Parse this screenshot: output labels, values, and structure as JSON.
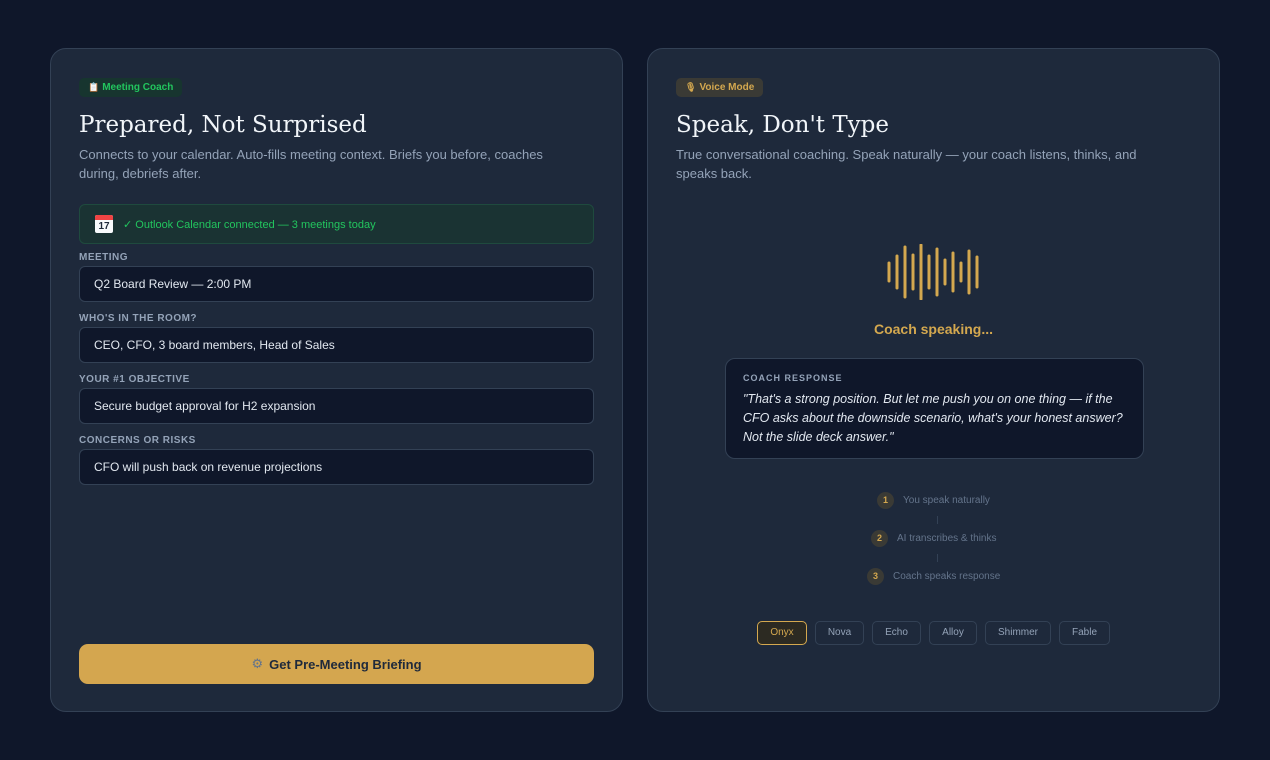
{
  "left_card": {
    "badge_label": "Meeting Coach",
    "badge_icon": "clipboard-icon",
    "title": "Prepared, Not Surprised",
    "description": "Connects to your calendar. Auto-fills meeting context. Briefs you before, coaches during, debriefs after.",
    "calendar": {
      "icon": "calendar-icon",
      "icon_month": "JUL",
      "icon_day": "17",
      "status": "✓ Outlook Calendar connected — 3 meetings today"
    },
    "fields": [
      {
        "label": "MEETING",
        "value": "Q2 Board Review — 2:00 PM"
      },
      {
        "label": "WHO'S IN THE ROOM?",
        "value": "CEO, CFO, 3 board members, Head of Sales"
      },
      {
        "label": "YOUR #1 OBJECTIVE",
        "value": "Secure budget approval for H2 expansion"
      },
      {
        "label": "CONCERNS OR RISKS",
        "value": "CFO will push back on revenue projections"
      }
    ],
    "cta_label": "Get Pre-Meeting Briefing",
    "cta_icon": "gear-icon"
  },
  "right_card": {
    "badge_label": "Voice Mode",
    "badge_icon": "microphone-icon",
    "title": "Speak, Don't Type",
    "description": "True conversational coaching. Speak naturally — your coach listens, thinks, and speaks back.",
    "status": "Coach speaking...",
    "response_label": "COACH RESPONSE",
    "response_text": "\"That's a strong position. But let me push you on one thing — if the CFO asks about the downside scenario, what's your honest answer? Not the slide deck answer.\"",
    "steps": [
      {
        "num": "1",
        "label": "You speak naturally"
      },
      {
        "num": "2",
        "label": "AI transcribes & thinks"
      },
      {
        "num": "3",
        "label": "Coach speaks response"
      }
    ],
    "voices": [
      "Onyx",
      "Nova",
      "Echo",
      "Alloy",
      "Shimmer",
      "Fable"
    ],
    "selected_voice": "Onyx"
  },
  "colors": {
    "background": "#0f172a",
    "card": "#1e293b",
    "accent_gold": "#d4a64f",
    "accent_green": "#22c55e"
  }
}
